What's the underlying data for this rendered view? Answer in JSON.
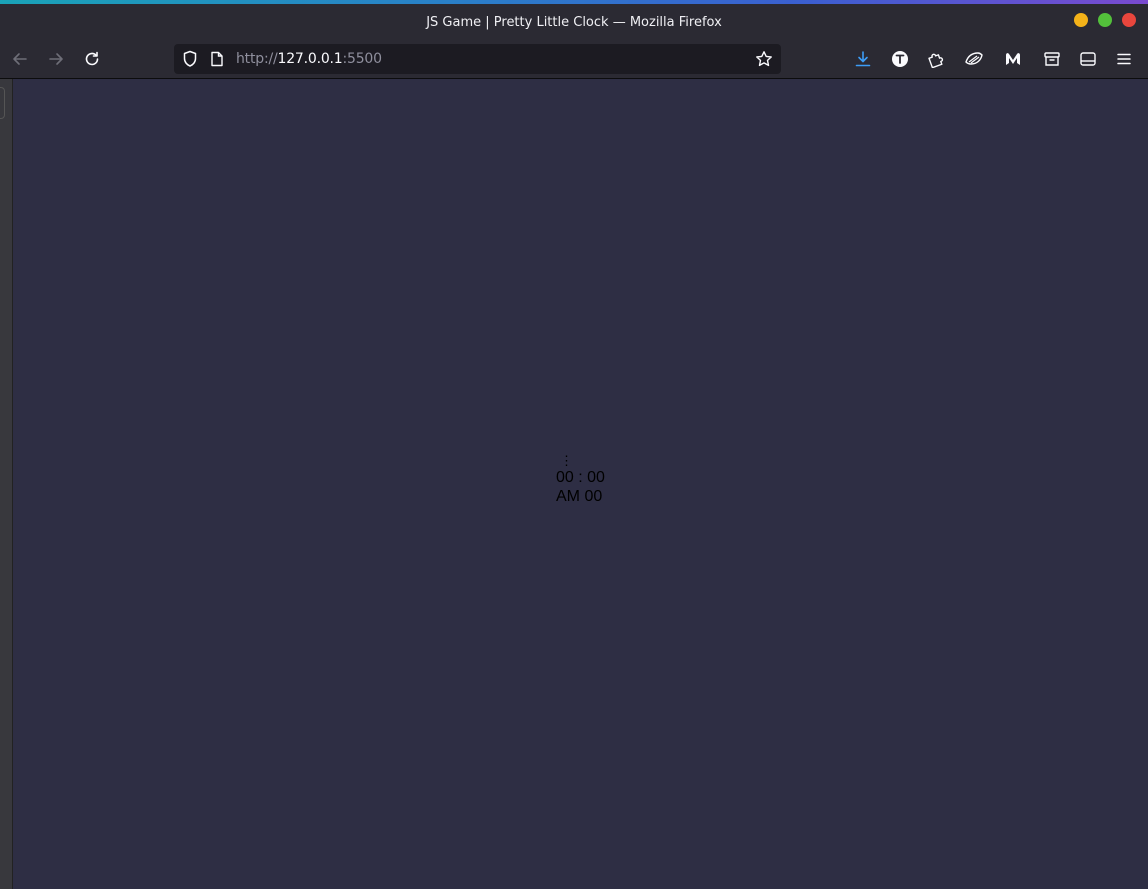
{
  "window": {
    "title": "JS Game | Pretty Little Clock — Mozilla Firefox"
  },
  "toolbar": {
    "url_prefix": "http://",
    "url_host": "127.0.0.1",
    "url_port": ":5500"
  },
  "clock": {
    "menu_glyph": "⋮",
    "time": "00 : 00",
    "period_line": "AM 00"
  },
  "colors": {
    "page_background": "#2e2e44",
    "chrome_background": "#2b2a33",
    "download_accent": "#3d9df7"
  }
}
